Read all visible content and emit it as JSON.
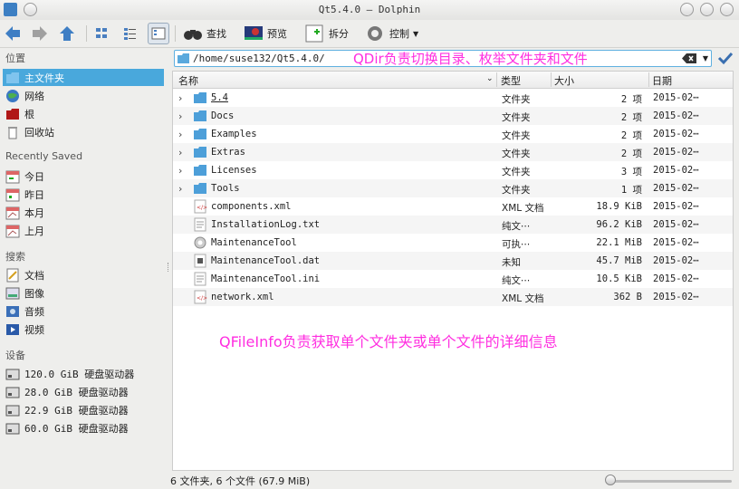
{
  "window": {
    "title": "Qt5.4.0 — Dolphin"
  },
  "toolbar": {
    "find": "查找",
    "preview": "预览",
    "split": "拆分",
    "control": "控制"
  },
  "sidebar": {
    "places_title": "位置",
    "places": [
      {
        "label": "主文件夹",
        "icon": "home-folder-icon"
      },
      {
        "label": "网络",
        "icon": "network-icon"
      },
      {
        "label": "根",
        "icon": "root-folder-icon"
      },
      {
        "label": "回收站",
        "icon": "trash-icon"
      }
    ],
    "recent_title": "Recently Saved",
    "recent": [
      {
        "label": "今日",
        "icon": "calendar-today-icon"
      },
      {
        "label": "昨日",
        "icon": "calendar-yesterday-icon"
      },
      {
        "label": "本月",
        "icon": "calendar-month-icon"
      },
      {
        "label": "上月",
        "icon": "calendar-last-month-icon"
      }
    ],
    "search_title": "搜索",
    "search": [
      {
        "label": "文档",
        "icon": "documents-icon"
      },
      {
        "label": "图像",
        "icon": "images-icon"
      },
      {
        "label": "音频",
        "icon": "audio-icon"
      },
      {
        "label": "视频",
        "icon": "video-icon"
      }
    ],
    "devices_title": "设备",
    "devices": [
      {
        "label": "120.0 GiB 硬盘驱动器",
        "icon": "harddisk-icon"
      },
      {
        "label": "28.0 GiB 硬盘驱动器",
        "icon": "harddisk-icon"
      },
      {
        "label": "22.9 GiB 硬盘驱动器",
        "icon": "harddisk-icon"
      },
      {
        "label": "60.0 GiB 硬盘驱动器",
        "icon": "harddisk-icon"
      }
    ]
  },
  "location": {
    "path": "/home/suse132/Qt5.4.0/"
  },
  "annotations": {
    "top": "QDir负责切换目录、枚举文件夹和文件",
    "middle": "QFileInfo负责获取单个文件夹或单个文件的详细信息"
  },
  "columns": {
    "name": "名称",
    "type": "类型",
    "size": "大小",
    "date": "日期"
  },
  "files": [
    {
      "name": "5.4",
      "type": "文件夹",
      "size": "2 项",
      "date": "2015-02⋯",
      "kind": "folder"
    },
    {
      "name": "Docs",
      "type": "文件夹",
      "size": "2 项",
      "date": "2015-02⋯",
      "kind": "folder"
    },
    {
      "name": "Examples",
      "type": "文件夹",
      "size": "2 项",
      "date": "2015-02⋯",
      "kind": "folder"
    },
    {
      "name": "Extras",
      "type": "文件夹",
      "size": "2 项",
      "date": "2015-02⋯",
      "kind": "folder"
    },
    {
      "name": "Licenses",
      "type": "文件夹",
      "size": "3 项",
      "date": "2015-02⋯",
      "kind": "folder"
    },
    {
      "name": "Tools",
      "type": "文件夹",
      "size": "1 项",
      "date": "2015-02⋯",
      "kind": "folder"
    },
    {
      "name": "components.xml",
      "type": "XML 文档",
      "size": "18.9 KiB",
      "date": "2015-02⋯",
      "kind": "xml"
    },
    {
      "name": "InstallationLog.txt",
      "type": "纯文⋯",
      "size": "96.2 KiB",
      "date": "2015-02⋯",
      "kind": "text"
    },
    {
      "name": "MaintenanceTool",
      "type": "可执⋯",
      "size": "22.1 MiB",
      "date": "2015-02⋯",
      "kind": "exec"
    },
    {
      "name": "MaintenanceTool.dat",
      "type": "未知",
      "size": "45.7 MiB",
      "date": "2015-02⋯",
      "kind": "unknown"
    },
    {
      "name": "MaintenanceTool.ini",
      "type": "纯文⋯",
      "size": "10.5 KiB",
      "date": "2015-02⋯",
      "kind": "text"
    },
    {
      "name": "network.xml",
      "type": "XML 文档",
      "size": "362 B",
      "date": "2015-02⋯",
      "kind": "xml"
    }
  ],
  "status": {
    "text": "6 文件夹, 6 个文件 (67.9 MiB)"
  }
}
